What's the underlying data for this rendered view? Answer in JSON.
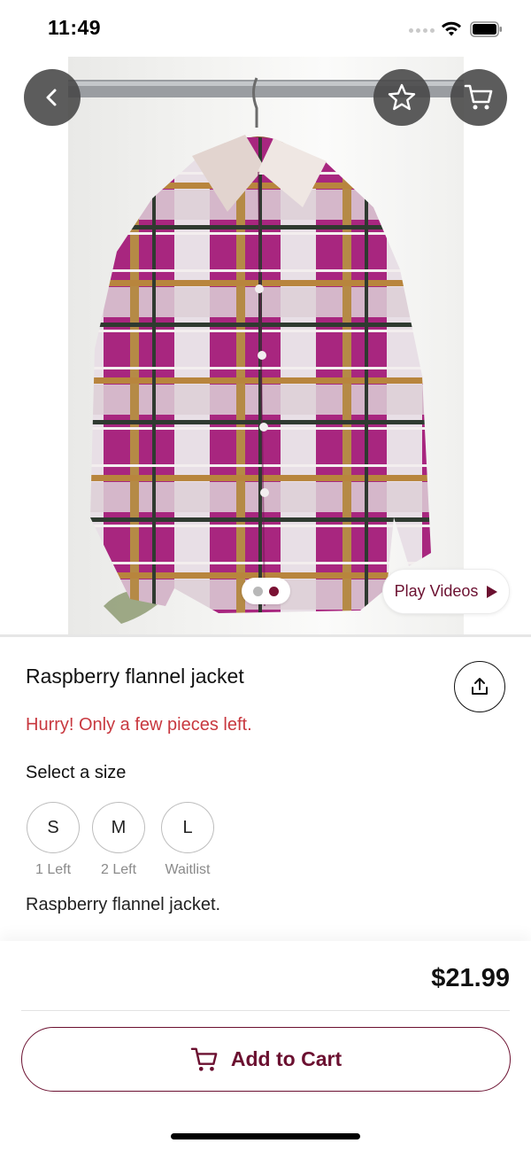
{
  "status_bar": {
    "time": "11:49",
    "icons": [
      "signal-dots-icon",
      "wifi-icon",
      "battery-icon"
    ]
  },
  "hero": {
    "image": "plaid-flannel-jacket-on-hanger-photo",
    "actions": [
      "back-arrow-icon",
      "star-icon",
      "cart-icon"
    ],
    "pager": {
      "count": 2,
      "active_index": 1
    },
    "play_videos_label": "Play Videos"
  },
  "product": {
    "title": "Raspberry flannel jacket",
    "stock_warning": "Hurry! Only a few pieces left.",
    "size_heading": "Select a size",
    "sizes": [
      {
        "label": "S",
        "note": "1 Left"
      },
      {
        "label": "M",
        "note": "2 Left"
      },
      {
        "label": "L",
        "note": "Waitlist"
      }
    ],
    "description": "Raspberry flannel jacket."
  },
  "checkout": {
    "price": "$21.99",
    "add_to_cart_label": "Add to Cart"
  },
  "colors": {
    "brand": "#6b1030",
    "warning": "#c8383f",
    "pager_active": "#7a1234",
    "jacket_magenta": "#a8267f"
  }
}
